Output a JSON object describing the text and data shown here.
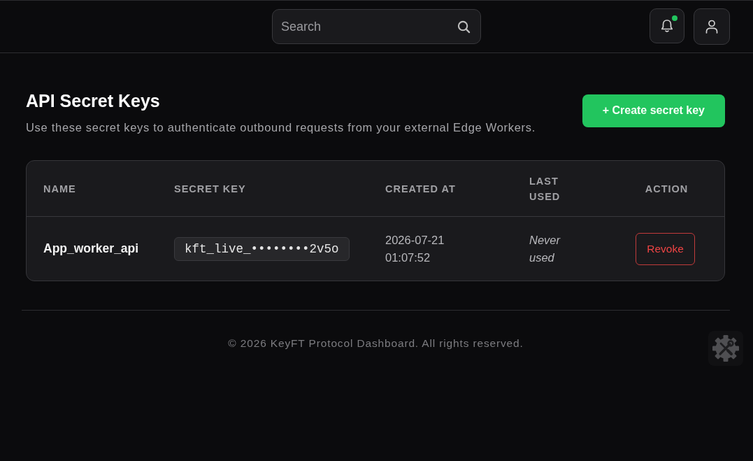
{
  "header": {
    "search": {
      "placeholder": "Search"
    },
    "notifications": {
      "unread": true
    }
  },
  "page": {
    "title": "API Secret Keys",
    "subtitle": "Use these secret keys to authenticate outbound requests from your external Edge Workers.",
    "create_button": "+ Create secret key"
  },
  "table": {
    "columns": [
      "NAME",
      "SECRET KEY",
      "CREATED AT",
      "LAST USED",
      "ACTION"
    ],
    "rows": [
      {
        "name": "App_worker_api",
        "secret_key": "kft_live_••••••••2v5o",
        "created_at": "2026-07-21 01:07:52",
        "last_used": "Never used",
        "action": "Revoke"
      }
    ]
  },
  "footer": {
    "text": "© 2026 KeyFT Protocol Dashboard. All rights reserved."
  }
}
